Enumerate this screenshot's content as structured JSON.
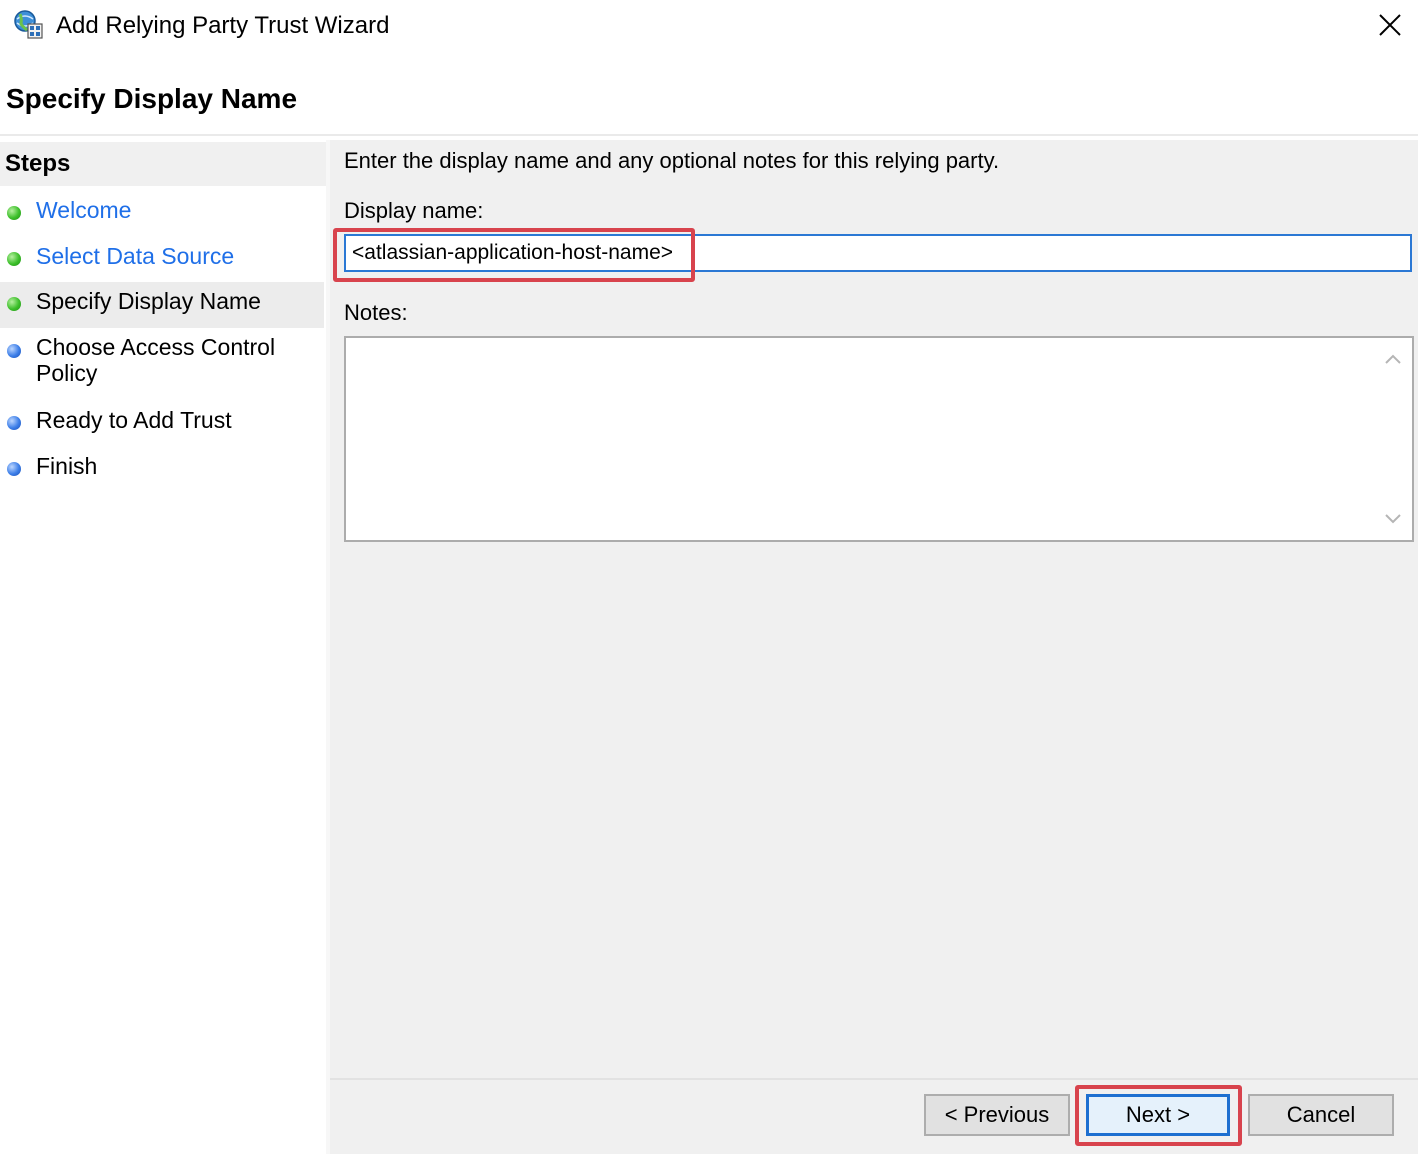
{
  "window": {
    "title": "Add Relying Party Trust Wizard",
    "icon": "adfs-trust-icon",
    "close_icon": "close-icon"
  },
  "header": {
    "page_title": "Specify Display Name"
  },
  "steps": {
    "heading": "Steps",
    "items": [
      {
        "label": "Welcome",
        "status": "completed",
        "link": true
      },
      {
        "label": "Select Data Source",
        "status": "completed",
        "link": true
      },
      {
        "label": "Specify Display Name",
        "status": "current",
        "link": false
      },
      {
        "label": "Choose Access Control Policy",
        "status": "pending",
        "link": false
      },
      {
        "label": "Ready to Add Trust",
        "status": "pending",
        "link": false
      },
      {
        "label": "Finish",
        "status": "pending",
        "link": false
      }
    ]
  },
  "main": {
    "instructions": "Enter the display name and any optional notes for this relying party.",
    "display_name_label": "Display name:",
    "display_name_value": "<atlassian-application-host-name>",
    "notes_label": "Notes:",
    "notes_value": ""
  },
  "footer": {
    "previous_label": "< Previous",
    "next_label": "Next >",
    "cancel_label": "Cancel"
  },
  "colors": {
    "link": "#1f6fe8",
    "highlight": "#d8434d",
    "focus": "#2b78d4",
    "completed_dot": "#3cbf2a",
    "pending_dot": "#3c7ee8"
  }
}
